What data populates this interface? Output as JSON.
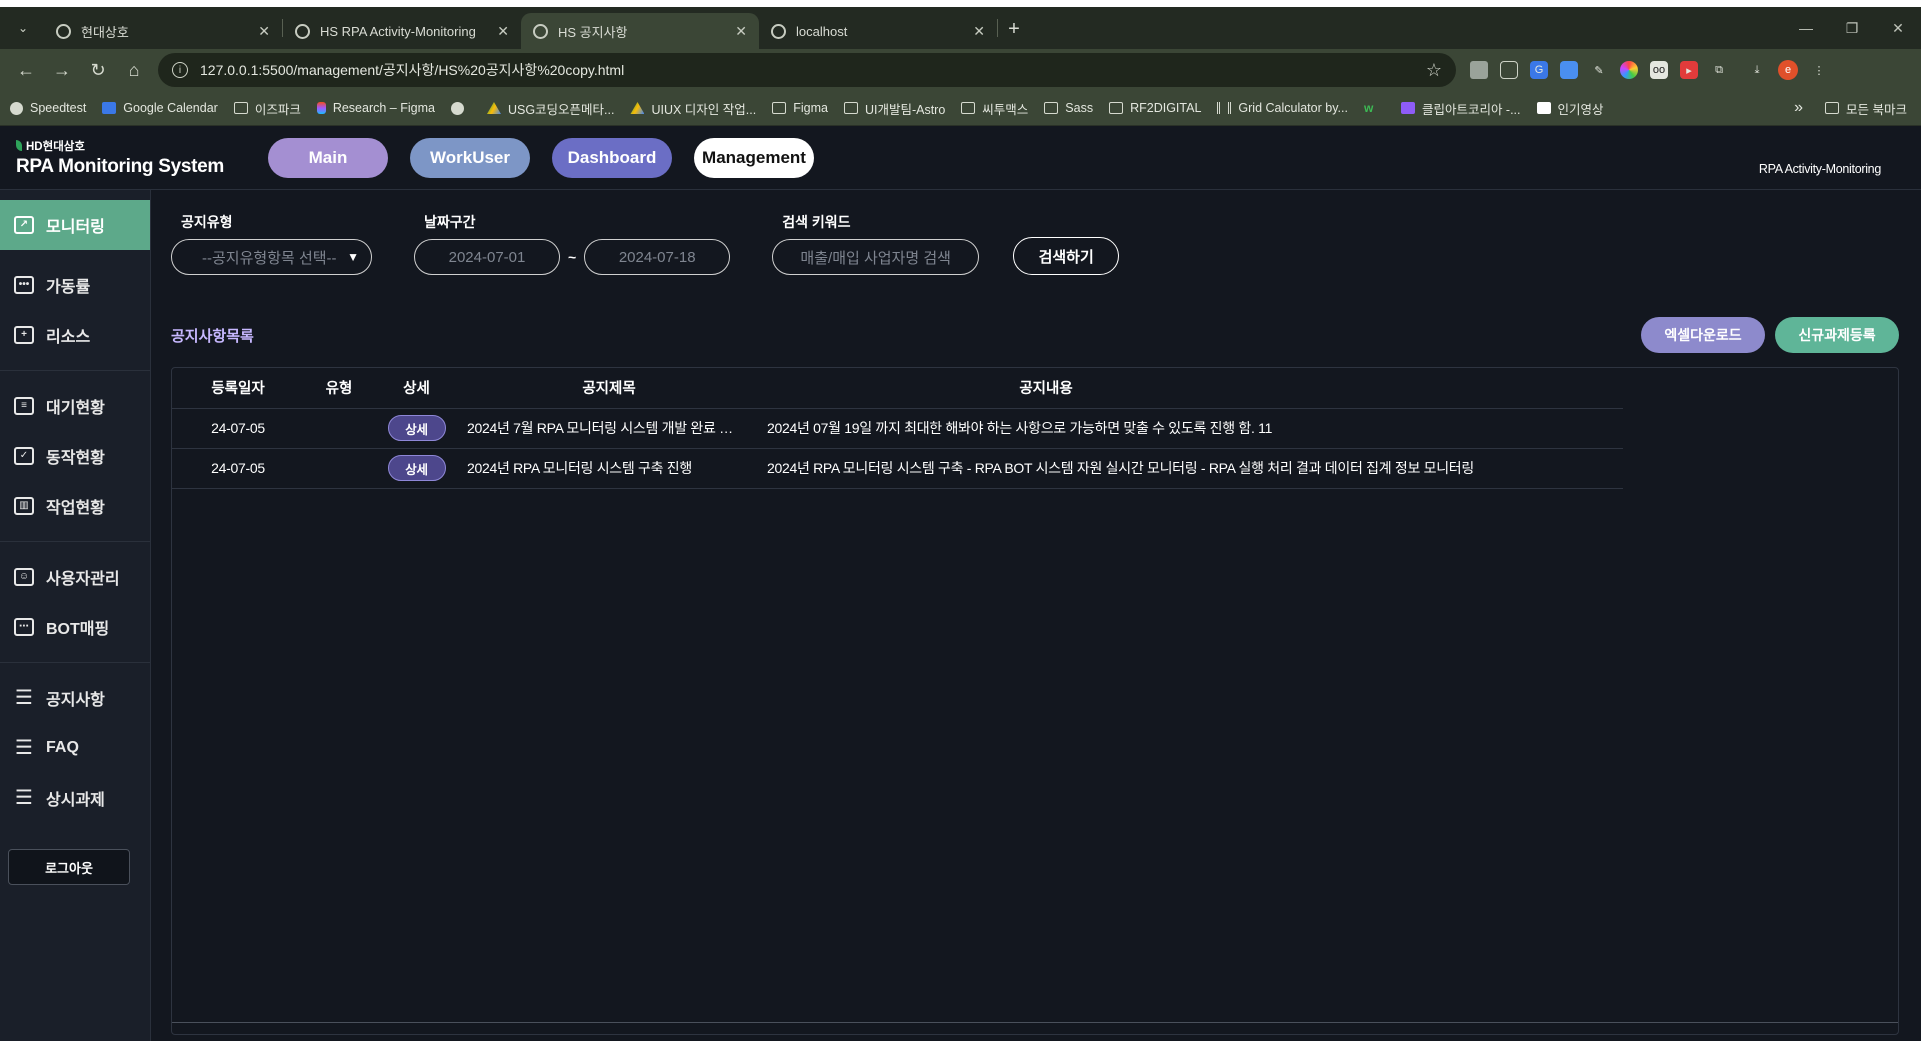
{
  "browser": {
    "tabs": [
      {
        "label": "현대상호",
        "active": false
      },
      {
        "label": "HS RPA Activity-Monitoring",
        "active": false
      },
      {
        "label": "HS 공지사항",
        "active": true
      },
      {
        "label": "localhost",
        "active": false
      }
    ],
    "url": "127.0.0.1:5500/management/공지사항/HS%20공지사항%20copy.html",
    "bookmarks": [
      {
        "label": "Speedtest",
        "icon": "gauge-icon"
      },
      {
        "label": "Google Calendar",
        "icon": "calendar-icon"
      },
      {
        "label": "이즈파크",
        "icon": "folder-icon"
      },
      {
        "label": "Research – Figma",
        "icon": "figma-icon"
      },
      {
        "label": "",
        "icon": "globe-icon"
      },
      {
        "label": "USG코딩오픈메타...",
        "icon": "drive-icon"
      },
      {
        "label": "UIUX 디자인 작업...",
        "icon": "drive-icon"
      },
      {
        "label": "Figma",
        "icon": "folder-icon"
      },
      {
        "label": "UI개발팀-Astro",
        "icon": "folder-icon"
      },
      {
        "label": "씨투맥스",
        "icon": "folder-icon"
      },
      {
        "label": "Sass",
        "icon": "folder-icon"
      },
      {
        "label": "RF2DIGITAL",
        "icon": "folder-icon"
      },
      {
        "label": "Grid Calculator by...",
        "icon": "grid-icon"
      },
      {
        "label": "",
        "icon": "w-icon"
      },
      {
        "label": "클립아트코리아 -...",
        "icon": "ck-icon"
      },
      {
        "label": "인기영상",
        "icon": "t-icon"
      }
    ],
    "bookmarks_more": "»",
    "all_bookmarks": "모든 북마크",
    "profile_letter": "e"
  },
  "app": {
    "brand_small": "HD현대삼호",
    "brand_big": "RPA Monitoring System",
    "nav": {
      "main": "Main",
      "workuser": "WorkUser",
      "dashboard": "Dashboard",
      "management": "Management"
    },
    "header_right": "RPA Activity-Monitoring",
    "sidebar": {
      "monitoring": "모니터링",
      "uptime": "가동률",
      "resource": "리소스",
      "queue": "대기현황",
      "action": "동작현황",
      "job": "작업현황",
      "users": "사용자관리",
      "bot": "BOT매핑",
      "notice": "공지사항",
      "faq": "FAQ",
      "standing": "상시과제",
      "logout": "로그아웃"
    },
    "filters": {
      "type_label": "공지유형",
      "type_placeholder": "--공지유형항목 선택--",
      "date_label": "날짜구간",
      "date_from": "2024-07-01",
      "date_sep": "~",
      "date_to": "2024-07-18",
      "keyword_label": "검색 키워드",
      "keyword_placeholder": "매출/매입 사업자명 검색",
      "search_button": "검색하기"
    },
    "list": {
      "title": "공지사항목록",
      "excel_button": "엑셀다운로드",
      "new_button": "신규과제등록",
      "columns": [
        "등록일자",
        "유형",
        "상세",
        "공지제목",
        "공지내용"
      ],
      "rows": [
        {
          "date": "24-07-05",
          "type": "",
          "detail": "상세",
          "title": "2024년 7월 RPA 모니터링 시스템 개발 완료 …",
          "content": "2024년 07월 19일 까지 최대한 해봐야 하는 사항으로 가능하면 맞출 수 있도록 진행 함. 11"
        },
        {
          "date": "24-07-05",
          "type": "",
          "detail": "상세",
          "title": "2024년 RPA 모니터링 시스템 구축 진행",
          "content": "2024년 RPA 모니터링 시스템 구축 - RPA BOT 시스템 자원 실시간 모니터링 - RPA 실행 처리 결과 데이터 집계 정보 모니터링"
        }
      ]
    }
  }
}
